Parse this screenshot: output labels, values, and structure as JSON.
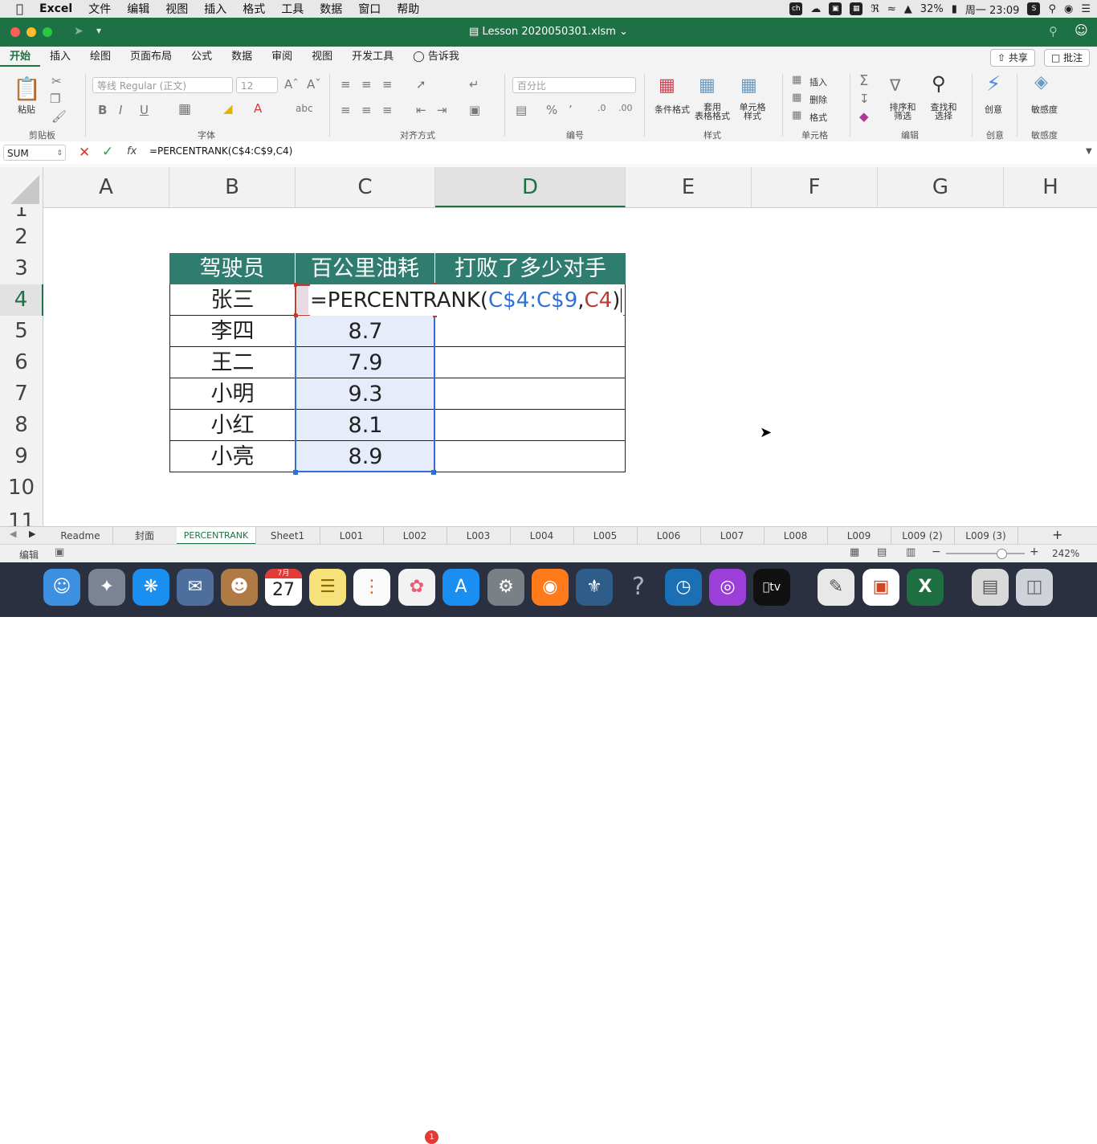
{
  "menubar": {
    "app": "Excel",
    "items": [
      "文件",
      "编辑",
      "视图",
      "插入",
      "格式",
      "工具",
      "数据",
      "窗口",
      "帮助"
    ],
    "battery": "32%",
    "clock": "周一 23:09"
  },
  "window": {
    "title": "Lesson 2020050301.xlsm"
  },
  "ribbon_tabs": [
    "开始",
    "插入",
    "绘图",
    "页面布局",
    "公式",
    "数据",
    "审阅",
    "视图",
    "开发工具"
  ],
  "tell_me": "告诉我",
  "share_label": "共享",
  "comment_label": "批注",
  "ribbon": {
    "paste": "粘贴",
    "font_name": "等线 Regular (正文)",
    "font_size": "12",
    "number_format": "百分比",
    "cond_format": "条件格式",
    "table_format": "套用\n表格格式",
    "cell_style": "单元格\n样式",
    "insert": "插入",
    "delete": "删除",
    "format": "格式",
    "sort_filter": "排序和\n筛选",
    "find_select": "查找和\n选择",
    "ideas": "创意",
    "sensitivity": "敏感度",
    "groups": {
      "clipboard": "剪贴板",
      "font": "字体",
      "alignment": "对齐方式",
      "number": "编号",
      "styles": "样式",
      "cells": "单元格",
      "editing": "编辑",
      "ideas": "创意",
      "sensitivity": "敏感度"
    }
  },
  "formula_bar": {
    "name_box": "SUM",
    "fx": "fx",
    "formula": "=PERCENTRANK(C$4:C$9,C4)"
  },
  "columns": [
    "A",
    "B",
    "C",
    "D",
    "E",
    "F",
    "G",
    "H"
  ],
  "rows": [
    "1",
    "2",
    "3",
    "4",
    "5",
    "6",
    "7",
    "8",
    "9",
    "10",
    "11"
  ],
  "table": {
    "headers": [
      "驾驶员",
      "百公里油耗",
      "打败了多少对手"
    ],
    "names": [
      "张三",
      "李四",
      "王二",
      "小明",
      "小红",
      "小亮"
    ],
    "values": [
      "",
      "8.7",
      "7.9",
      "9.3",
      "8.1",
      "8.9"
    ],
    "edit": {
      "prefix": "=PERCENTRANK(",
      "range": "C$4:C$9",
      "comma": ",",
      "ref": "C4",
      "suffix": ")"
    }
  },
  "sheet_tabs": [
    "Readme",
    "封面",
    "PERCENTRANK",
    "Sheet1",
    "L001",
    "L002",
    "L003",
    "L004",
    "L005",
    "L006",
    "L007",
    "L008",
    "L009",
    "L009 (2)",
    "L009 (3)"
  ],
  "status": {
    "mode": "编辑",
    "zoom": "242%"
  },
  "calendar": {
    "month": "7月",
    "day": "27"
  },
  "notification_badge": "1",
  "colors": {
    "excel_green": "#1e7145",
    "header_fill": "#2e7d6e",
    "range_blue": "#2f6fd6",
    "ref_red": "#c0392b"
  }
}
